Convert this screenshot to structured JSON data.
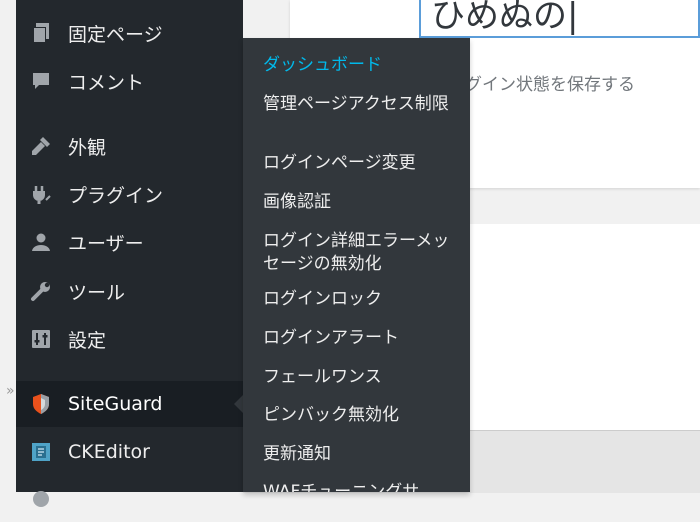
{
  "sidebar": {
    "items": [
      {
        "label": "固定ページ",
        "icon": "pages-icon"
      },
      {
        "label": "コメント",
        "icon": "comment-icon"
      },
      {
        "label": "外観",
        "icon": "appearance-icon"
      },
      {
        "label": "プラグイン",
        "icon": "plugin-icon"
      },
      {
        "label": "ユーザー",
        "icon": "user-icon"
      },
      {
        "label": "ツール",
        "icon": "wrench-icon"
      },
      {
        "label": "設定",
        "icon": "settings-icon"
      },
      {
        "label": "SiteGuard",
        "icon": "siteguard-icon"
      },
      {
        "label": "CKEditor",
        "icon": "ckeditor-icon"
      }
    ]
  },
  "submenu": {
    "items": [
      {
        "label": "ダッシュボード"
      },
      {
        "label": "管理ページアクセス制限"
      },
      {
        "label": "ログインページ変更"
      },
      {
        "label": "画像認証"
      },
      {
        "label": "ログイン詳細エラーメッセージの無効化"
      },
      {
        "label": "ログインロック"
      },
      {
        "label": "ログインアラート"
      },
      {
        "label": "フェールワンス"
      },
      {
        "label": "ピンバック無効化"
      },
      {
        "label": "更新通知"
      },
      {
        "label": "WAFチューニングサ"
      }
    ]
  },
  "content": {
    "input_value": "ひめぬの",
    "remember_label": "ログイン状態を保存する"
  },
  "colors": {
    "sidebar_bg": "#23282d",
    "submenu_bg": "#32373c",
    "accent": "#00b9eb",
    "active_bg": "#191e23"
  }
}
